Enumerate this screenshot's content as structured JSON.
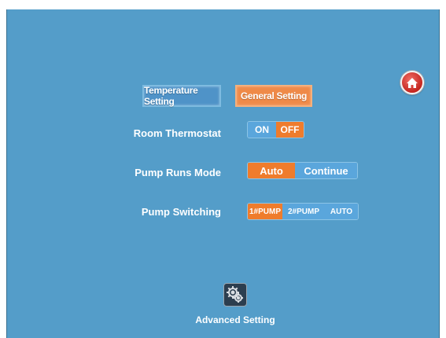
{
  "tabs": {
    "temperature": "Temperature Setting",
    "general": "General Setting"
  },
  "room_thermostat": {
    "label": "Room Thermostat",
    "options": [
      "ON",
      "OFF"
    ],
    "selected": "OFF"
  },
  "pump_runs_mode": {
    "label": "Pump Runs Mode",
    "options": [
      "Auto",
      "Continue"
    ],
    "selected": "Auto"
  },
  "pump_switching": {
    "label": "Pump Switching",
    "options": [
      "1#PUMP",
      "2#PUMP",
      "AUTO"
    ],
    "selected": "1#PUMP"
  },
  "advanced": {
    "label": "Advanced Setting",
    "icon": "gears-icon"
  },
  "home": {
    "icon": "home-icon"
  },
  "colors": {
    "background": "#549dc9",
    "active": "#ef7c2c",
    "inactive": "#5aa6dc"
  }
}
